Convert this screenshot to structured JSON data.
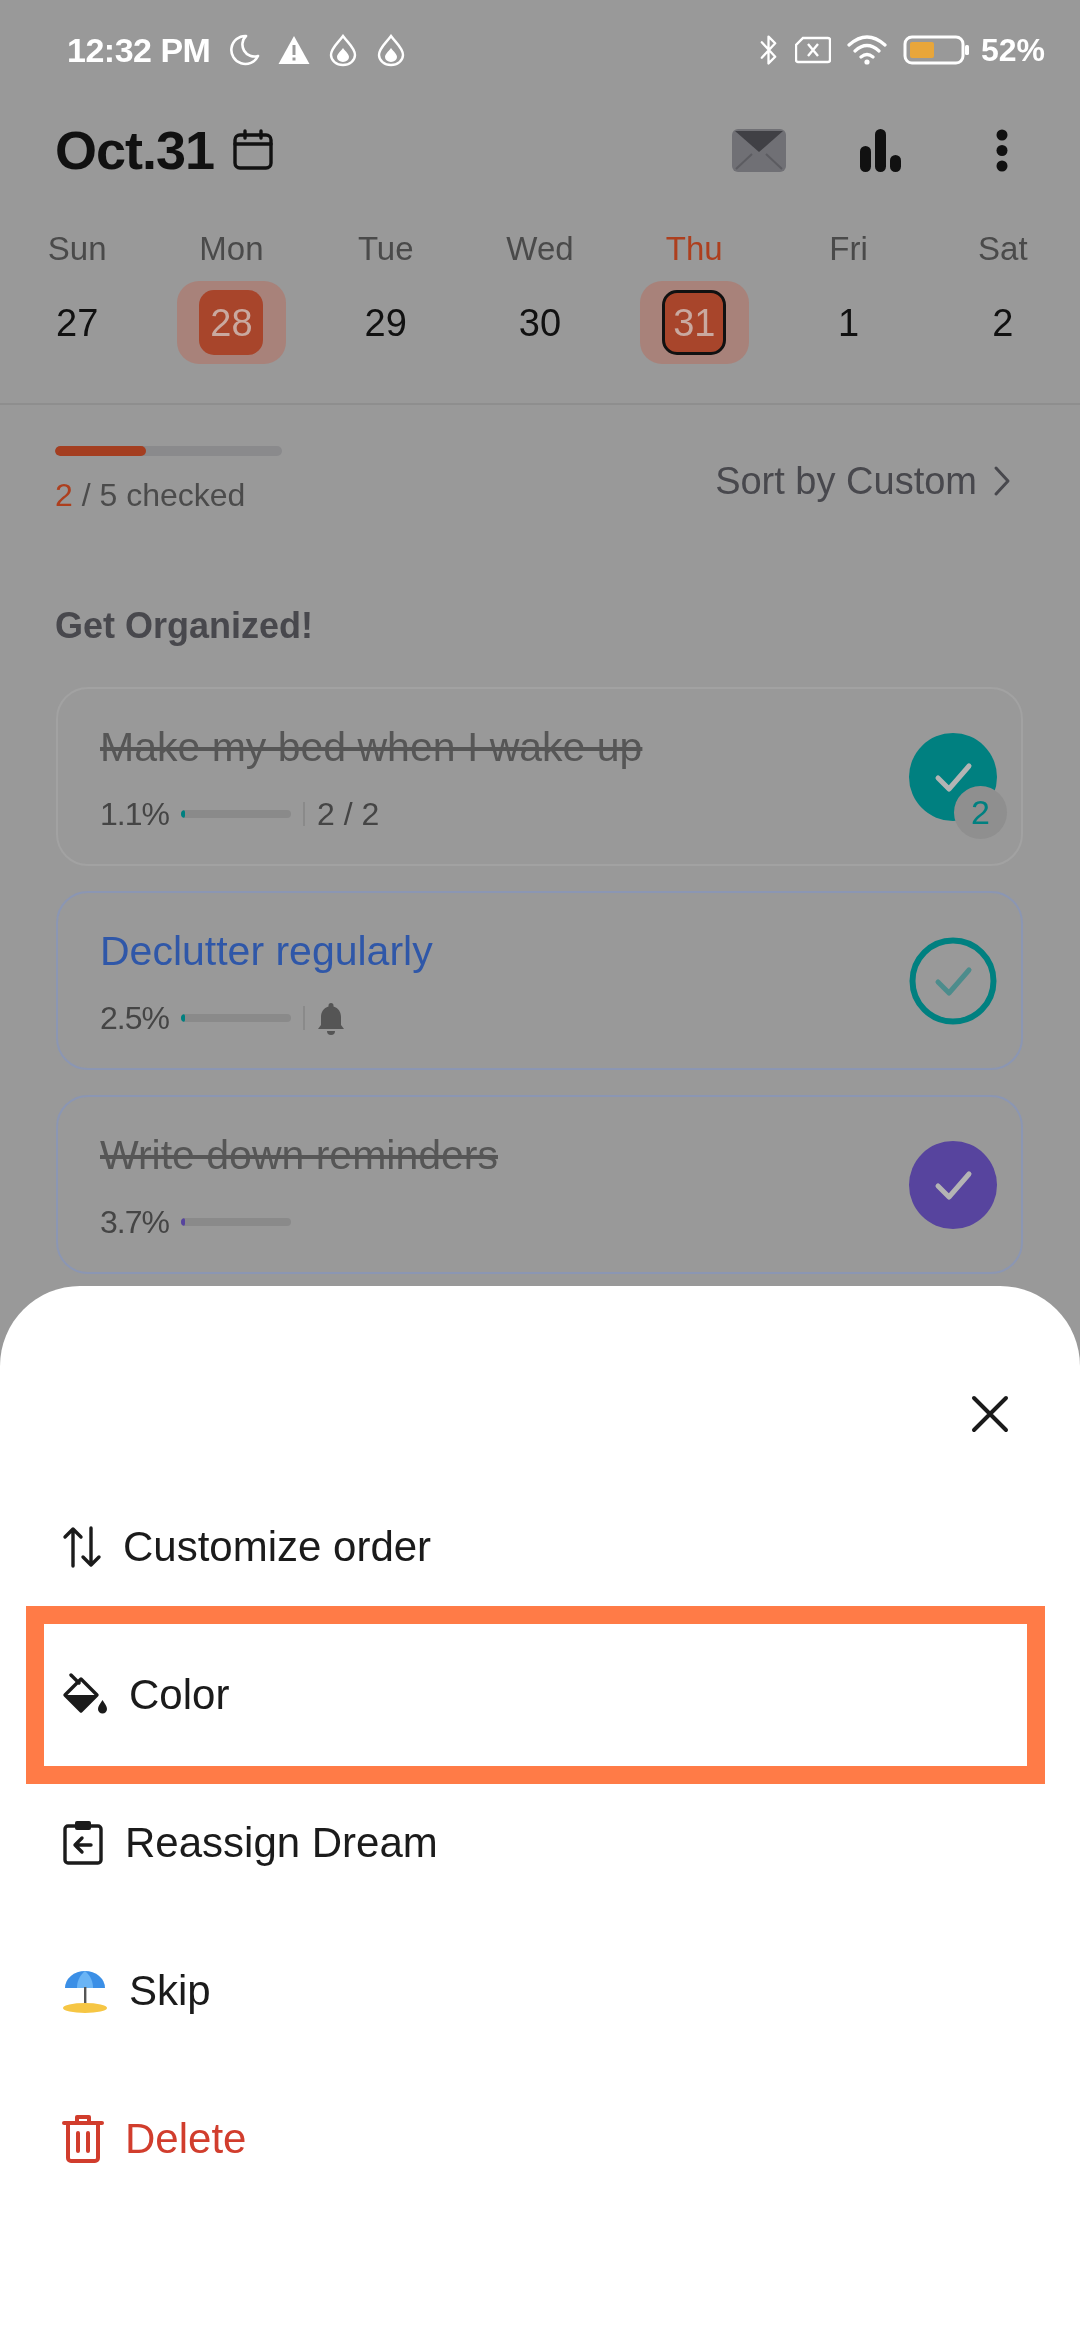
{
  "status_bar": {
    "time": "12:32 PM",
    "battery": "52%"
  },
  "header": {
    "title": "Oct.31"
  },
  "week": [
    {
      "weekday": "Sun",
      "date": "27",
      "today": false,
      "marked": false,
      "selected": false
    },
    {
      "weekday": "Mon",
      "date": "28",
      "today": false,
      "marked": true,
      "selected": false
    },
    {
      "weekday": "Tue",
      "date": "29",
      "today": false,
      "marked": false,
      "selected": false
    },
    {
      "weekday": "Wed",
      "date": "30",
      "today": false,
      "marked": false,
      "selected": false
    },
    {
      "weekday": "Thu",
      "date": "31",
      "today": true,
      "marked": true,
      "selected": true
    },
    {
      "weekday": "Fri",
      "date": "1",
      "today": false,
      "marked": false,
      "selected": false
    },
    {
      "weekday": "Sat",
      "date": "2",
      "today": false,
      "marked": false,
      "selected": false
    }
  ],
  "progress": {
    "level": 0.4,
    "done": "2",
    "label": "/ 5 checked",
    "sort": "Sort by Custom"
  },
  "section": {
    "title": "Get Organized!"
  },
  "tasks": [
    {
      "title": "Make my bed when I wake up",
      "checked": true,
      "selected": false,
      "outlined": false,
      "color": "#008080",
      "percent": "1.1%",
      "level": 0.011,
      "count": "2 / 2",
      "reminder": false,
      "badge": "2"
    },
    {
      "title": "Declutter regularly",
      "checked": false,
      "selected": true,
      "outlined": true,
      "color": "#008080",
      "percent": "2.5%",
      "level": 0.025,
      "reminder": true
    },
    {
      "title": "Write down reminders",
      "checked": true,
      "selected": false,
      "outlined": true,
      "color": "#57449e",
      "percent": "3.7%",
      "level": 0.037,
      "reminder": false
    }
  ],
  "sheet": {
    "items": [
      {
        "kind": "reorder",
        "label": "Customize order",
        "highlighted": false,
        "danger": false
      },
      {
        "kind": "color",
        "label": "Color",
        "highlighted": true,
        "danger": false
      },
      {
        "kind": "reassign",
        "label": "Reassign Dream",
        "highlighted": false,
        "danger": false
      },
      {
        "kind": "skip",
        "label": "Skip",
        "highlighted": false,
        "danger": false
      },
      {
        "kind": "delete",
        "label": "Delete",
        "highlighted": false,
        "danger": true
      }
    ]
  }
}
